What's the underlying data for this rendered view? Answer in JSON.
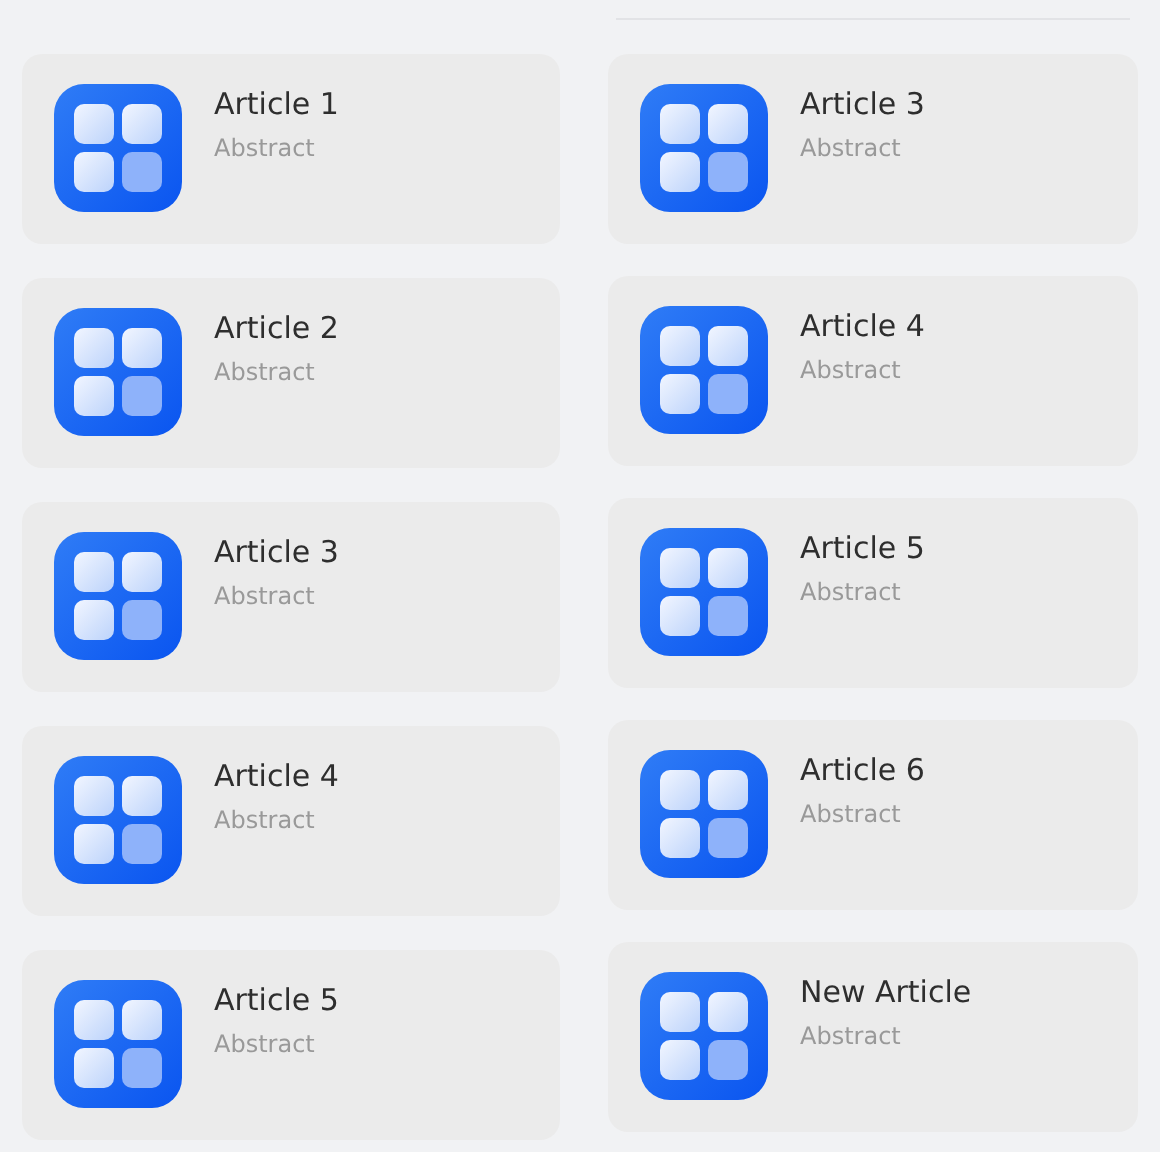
{
  "columns": [
    {
      "divider": false,
      "articles": [
        {
          "title": "Article 1",
          "abstract": "Abstract"
        },
        {
          "title": "Article 2",
          "abstract": "Abstract"
        },
        {
          "title": "Article 3",
          "abstract": "Abstract"
        },
        {
          "title": "Article 4",
          "abstract": "Abstract"
        },
        {
          "title": "Article 5",
          "abstract": "Abstract"
        }
      ]
    },
    {
      "divider": true,
      "articles": [
        {
          "title": "Article 3",
          "abstract": "Abstract"
        },
        {
          "title": "Article 4",
          "abstract": "Abstract"
        },
        {
          "title": "Article 5",
          "abstract": "Abstract"
        },
        {
          "title": "Article 6",
          "abstract": "Abstract"
        },
        {
          "title": "New Article",
          "abstract": "Abstract"
        }
      ]
    }
  ]
}
